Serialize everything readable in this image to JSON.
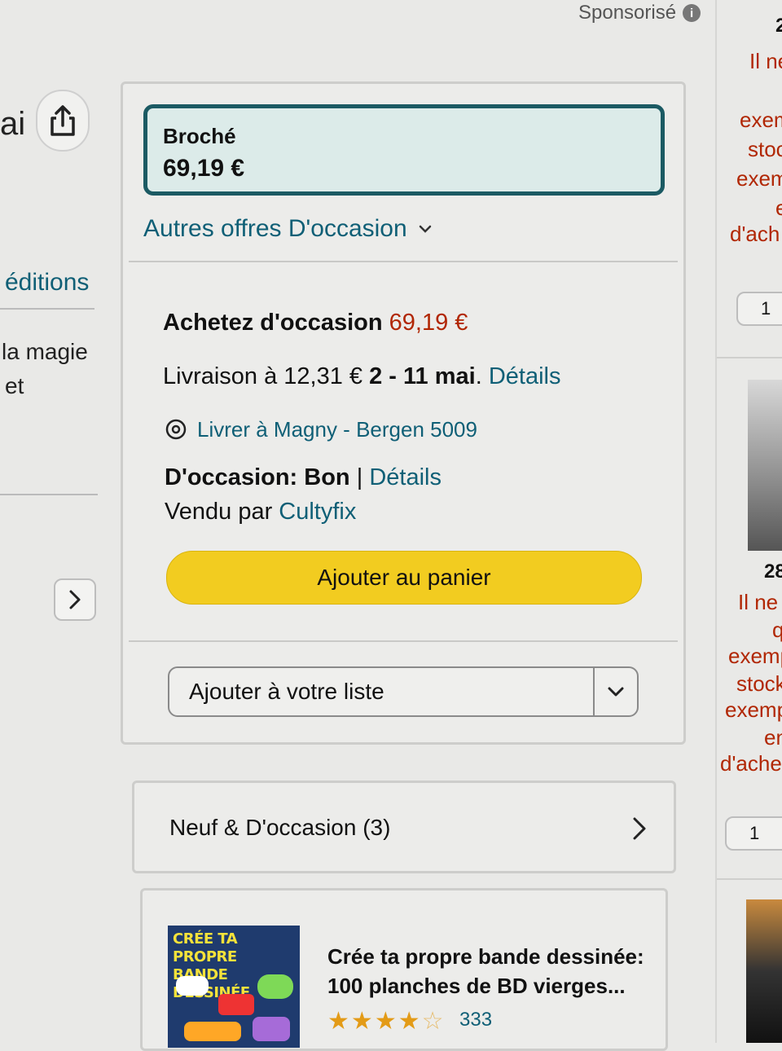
{
  "header": {
    "sponsor_label": "Sponsorisé",
    "info_icon_glyph": "i"
  },
  "left_panel": {
    "title_fragment": "ai",
    "editions_link": "éditions",
    "snippet_line1": "la magie",
    "snippet_line2": "et"
  },
  "buybox": {
    "format": {
      "name": "Broché",
      "price": "69,19 €"
    },
    "other_offers_label": "Autres offres D'occasion",
    "buy_used_label": "Achetez d'occasion",
    "buy_used_price": "69,19 €",
    "delivery": {
      "prefix": "Livraison à 12,31 €",
      "dates": "2 - 11 mai",
      "period": ".",
      "details_link": "Détails"
    },
    "location_label": "Livrer à Magny - Bergen 5009",
    "condition": {
      "label": "D'occasion: Bon",
      "separator": "|",
      "details_link": "Détails"
    },
    "seller": {
      "prefix": "Vendu par",
      "name": "Cultyfix"
    },
    "add_to_cart_label": "Ajouter au panier",
    "add_to_list_label": "Ajouter à votre liste"
  },
  "new_used": {
    "label": "Neuf & D'occasion (3)"
  },
  "sponsored_product": {
    "cover_text": "CRÉE TA PROPRE BANDE DESSINÉE",
    "title": "Crée ta propre bande dessinée: 100 planches de BD vierges...",
    "rating": 4.5,
    "rating_count": "333"
  },
  "right_panel": {
    "fragments_top": [
      "2",
      "Il ne",
      "exem",
      "stoc",
      "exem",
      "e",
      "d'ach"
    ],
    "qty_1": "1",
    "fragments_mid": [
      "28",
      "Il ne",
      "q",
      "exemp",
      "stock",
      "exemp",
      "en",
      "d'acher"
    ],
    "qty_2": "1"
  },
  "colors": {
    "link": "#0f5f76",
    "price_red": "#b12704",
    "cart_button": "#f2cc20",
    "selected_border": "#1b5a63",
    "star": "#e39b17"
  }
}
